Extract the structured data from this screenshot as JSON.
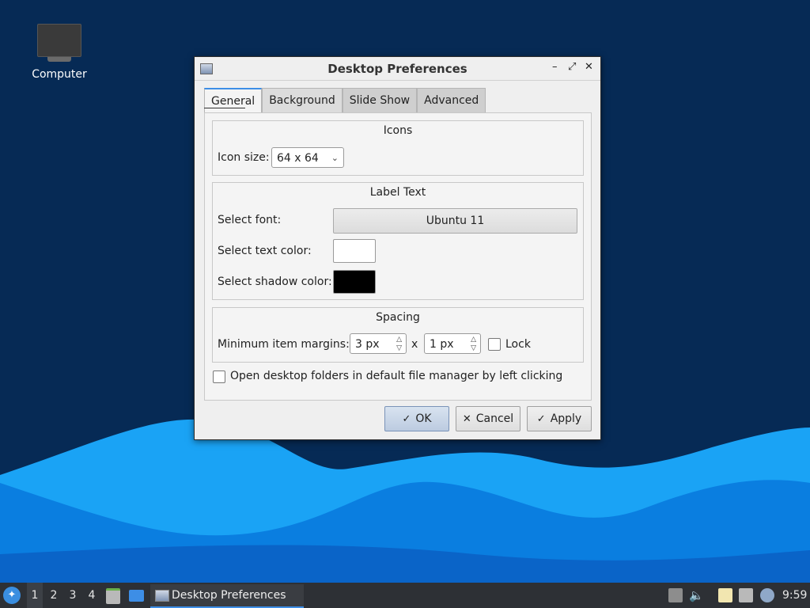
{
  "desktop": {
    "icons": [
      {
        "label": "Computer",
        "icon": "monitor-icon"
      }
    ]
  },
  "window": {
    "title": "Desktop Preferences",
    "controls": {
      "minimize": "–",
      "maximize": "⤢",
      "close": "✕"
    }
  },
  "tabs": [
    {
      "label": "General",
      "active": true
    },
    {
      "label": "Background",
      "active": false
    },
    {
      "label": "Slide Show",
      "active": false
    },
    {
      "label": "Advanced",
      "active": false
    }
  ],
  "icons_section": {
    "title": "Icons",
    "icon_size_label": "Icon size:",
    "icon_size_value": "64 x 64"
  },
  "label_text_section": {
    "title": "Label Text",
    "font_label": "Select font:",
    "font_value": "Ubuntu 11",
    "text_color_label": "Select text color:",
    "text_color": "#ffffff",
    "shadow_color_label": "Select shadow color:",
    "shadow_color": "#000000"
  },
  "spacing_section": {
    "title": "Spacing",
    "margins_label": "Minimum item margins:",
    "margin_x": "3 px",
    "separator": "x",
    "margin_y": "1 px",
    "lock_label": "Lock",
    "lock_checked": false
  },
  "open_folders_label": "Open desktop folders in default file manager by left clicking",
  "open_folders_checked": false,
  "buttons": {
    "ok": "OK",
    "cancel": "Cancel",
    "apply": "Apply"
  },
  "taskbar": {
    "workspaces": [
      "1",
      "2",
      "3",
      "4"
    ],
    "active_workspace": "1",
    "task_label": "Desktop Preferences",
    "clock": "9:59"
  },
  "colors": {
    "accent": "#3d8ee6",
    "desktop_bg": "#062a55",
    "wave_light": "#1aa3f5",
    "wave_dark": "#0a6fd6"
  }
}
